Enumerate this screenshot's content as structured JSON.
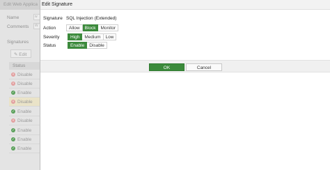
{
  "background": {
    "title": "Edit Web Applica",
    "fields": [
      {
        "label": "Name",
        "value": "w"
      },
      {
        "label": "Comments",
        "value": "W"
      }
    ],
    "section": "Signatures",
    "edit_label": "Edit",
    "table_header": "Status",
    "rows": [
      {
        "status": "Disable",
        "type": "disabled",
        "highlight": false
      },
      {
        "status": "Disable",
        "type": "disabled",
        "highlight": false
      },
      {
        "status": "Enable",
        "type": "enabled",
        "highlight": false
      },
      {
        "status": "Disable",
        "type": "disabled",
        "highlight": true
      },
      {
        "status": "Enable",
        "type": "enabled",
        "highlight": false
      },
      {
        "status": "Disable",
        "type": "disabled",
        "highlight": false
      },
      {
        "status": "Enable",
        "type": "enabled",
        "highlight": false
      },
      {
        "status": "Enable",
        "type": "enabled",
        "highlight": false
      },
      {
        "status": "Enable",
        "type": "enabled",
        "highlight": false
      }
    ]
  },
  "dialog": {
    "title": "Edit Signature",
    "signature": {
      "label": "Signature",
      "value": "SQL Injection (Extended)"
    },
    "action": {
      "label": "Action",
      "options": [
        "Allow",
        "Block",
        "Monitor"
      ],
      "selected": "Block"
    },
    "severity": {
      "label": "Severity",
      "options": [
        "High",
        "Medium",
        "Low"
      ],
      "selected": "High"
    },
    "status": {
      "label": "Status",
      "options": [
        "Enable",
        "Disable"
      ],
      "selected": "Enable"
    },
    "ok_label": "OK",
    "cancel_label": "Cancel"
  },
  "colors": {
    "accent": "#3c8a3c",
    "enabled_icon": "#5aa05a",
    "disabled_icon": "#e2a0a0"
  }
}
